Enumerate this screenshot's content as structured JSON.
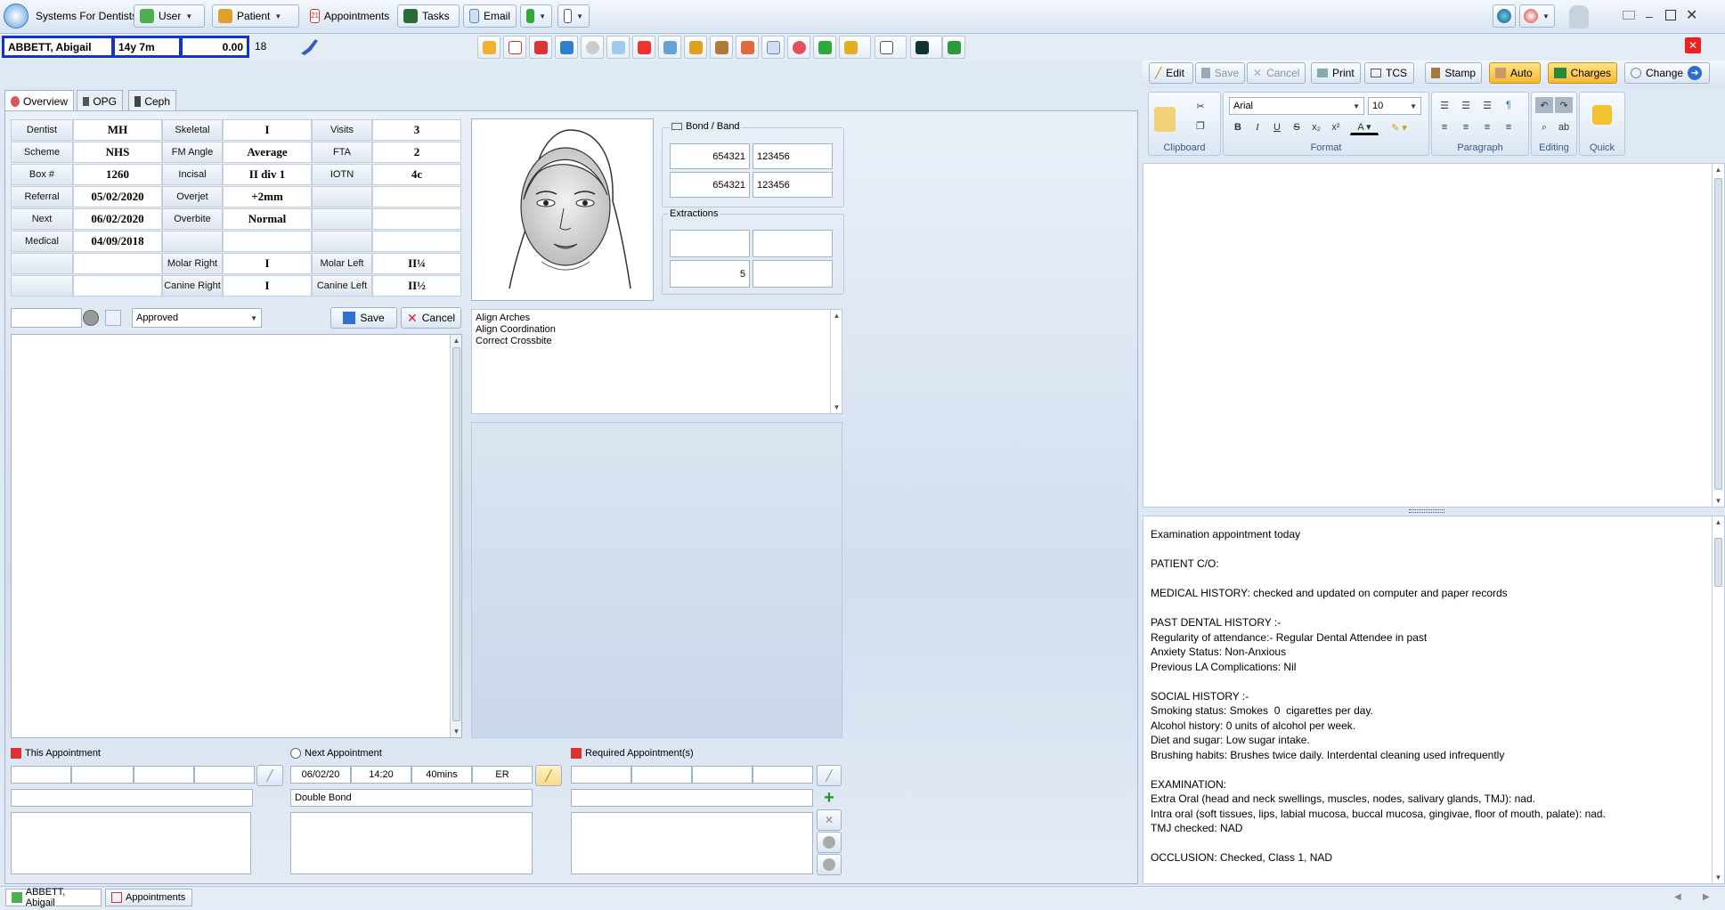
{
  "app": {
    "title": "Systems For Dentists"
  },
  "menu": {
    "user": "User",
    "patient": "Patient",
    "appointments": "Appointments",
    "tasks": "Tasks",
    "email": "Email"
  },
  "patient": {
    "name": "ABBETT, Abigail",
    "age": "14y 7m",
    "balance": "0.00",
    "count": "18"
  },
  "tabs": {
    "overview": "Overview",
    "opg": "OPG",
    "ceph": "Ceph"
  },
  "grid": {
    "rows": [
      [
        "Dentist",
        "MH",
        "Skeletal",
        "I",
        "Visits",
        "3"
      ],
      [
        "Scheme",
        "NHS",
        "FM Angle",
        "Average",
        "FTA",
        "2"
      ],
      [
        "Box #",
        "1260",
        "Incisal",
        "II div 1",
        "IOTN",
        "4c"
      ],
      [
        "Referral",
        "05/02/2020",
        "Overjet",
        "+2mm",
        "",
        ""
      ],
      [
        "Next",
        "06/02/2020",
        "Overbite",
        "Normal",
        "",
        ""
      ],
      [
        "Medical",
        "04/09/2018",
        "",
        "",
        "",
        ""
      ],
      [
        "",
        "",
        "Molar Right",
        "I",
        "Molar Left",
        "II¼"
      ],
      [
        "",
        "",
        "Canine Right",
        "I",
        "Canine Left",
        "II½"
      ]
    ]
  },
  "status": {
    "selected": "Approved",
    "save": "Save",
    "cancel": "Cancel"
  },
  "bond": {
    "title": "Bond / Band",
    "r1a": "654321",
    "r1b": "123456",
    "r2a": "654321",
    "r2b": "123456"
  },
  "extractions": {
    "title": "Extractions",
    "c": "5"
  },
  "aims": [
    "Align Arches",
    "Align Coordination",
    "Correct Crossbite"
  ],
  "appointments": {
    "this_title": "This Appointment",
    "next_title": "Next Appointment",
    "required_title": "Required Appointment(s)",
    "next_date": "06/02/20",
    "next_time": "14:20",
    "next_duration": "40mins",
    "next_code": "ER",
    "next_type": "Double Bond"
  },
  "editor": {
    "edit": "Edit",
    "save": "Save",
    "cancel": "Cancel",
    "print": "Print",
    "tcs": "TCS",
    "stamp": "Stamp",
    "auto": "Auto",
    "charges": "Charges",
    "change": "Change",
    "font": "Arial",
    "size": "10",
    "groups": {
      "clipboard": "Clipboard",
      "format": "Format",
      "paragraph": "Paragraph",
      "editing": "Editing",
      "quick": "Quick"
    }
  },
  "notes": [
    "Examination appointment today",
    "",
    "PATIENT C/O:",
    "",
    "MEDICAL HISTORY: checked and updated on computer and paper records",
    "",
    "PAST DENTAL HISTORY :-",
    "Regularity of attendance:- Regular Dental Attendee in past",
    "Anxiety Status: Non-Anxious",
    "Previous LA Complications: Nil",
    "",
    "SOCIAL HISTORY :-",
    "Smoking status: Smokes  0  cigarettes per day.",
    "Alcohol history: 0 units of alcohol per week.",
    "Diet and sugar: Low sugar intake.",
    "Brushing habits: Brushes twice daily. Interdental cleaning used infrequently",
    "",
    "EXAMINATION:",
    "Extra Oral (head and neck swellings, muscles, nodes, salivary glands, TMJ): nad.",
    "Intra oral (soft tissues, lips, labial mucosa, buccal mucosa, gingivae, floor of mouth, palate): nad.",
    "TMJ checked: NAD",
    "",
    "OCCLUSION: Checked, Class 1, NAD"
  ],
  "taskbar": {
    "patient": "ABBETT, Abigail",
    "appointments": "Appointments"
  }
}
